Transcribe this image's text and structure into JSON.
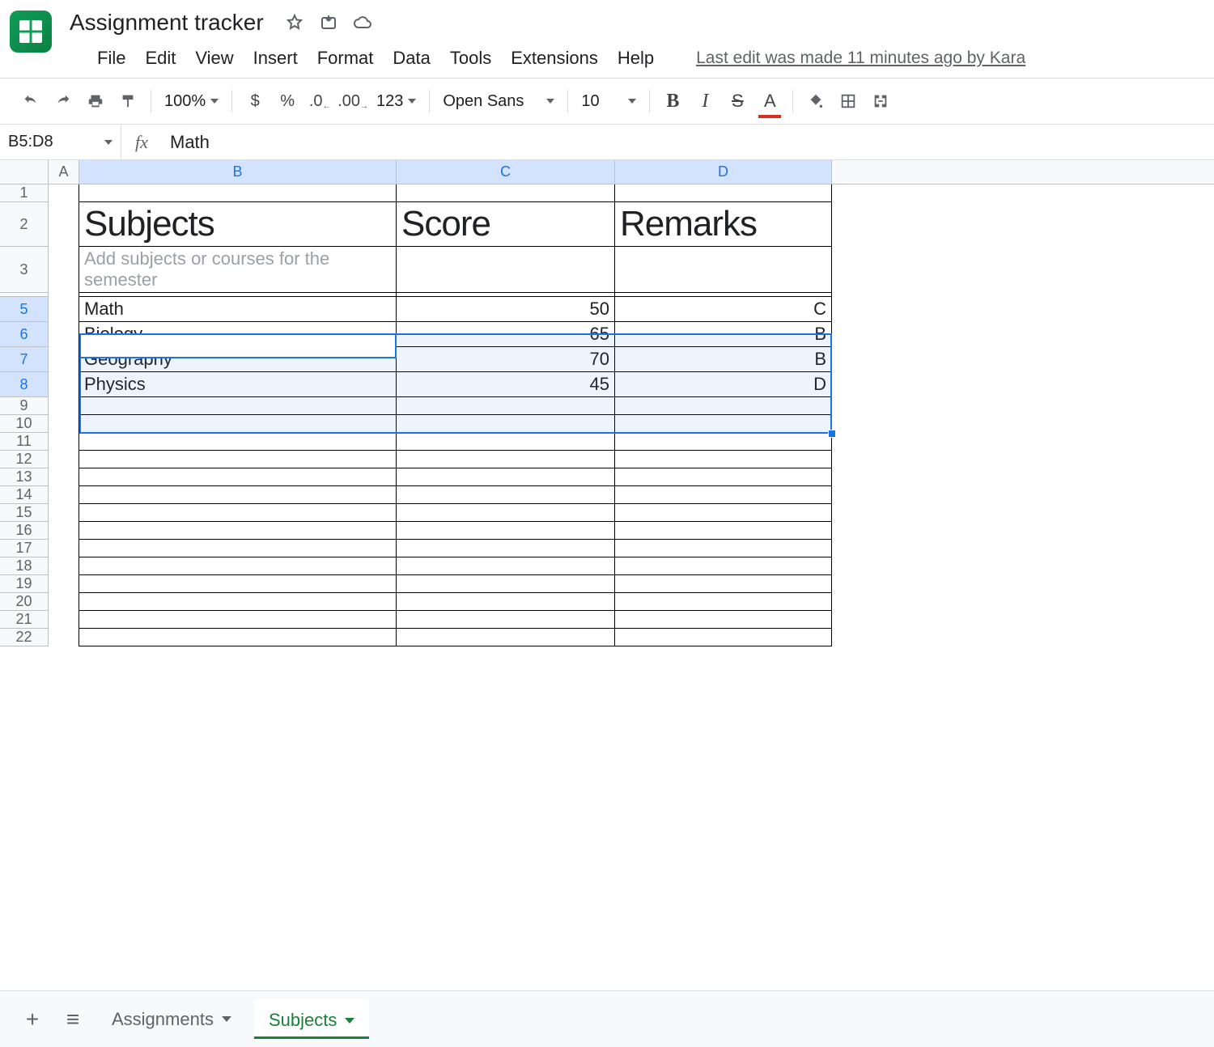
{
  "doc": {
    "title": "Assignment tracker",
    "last_edit": "Last edit was made 11 minutes ago by Kara"
  },
  "menu": {
    "file": "File",
    "edit": "Edit",
    "view": "View",
    "insert": "Insert",
    "format": "Format",
    "data": "Data",
    "tools": "Tools",
    "extensions": "Extensions",
    "help": "Help"
  },
  "toolbar": {
    "zoom": "100%",
    "currency": "$",
    "percent": "%",
    "dec_dec": ".0",
    "inc_dec": ".00",
    "more_formats": "123",
    "font": "Open Sans",
    "font_size": "10",
    "bold": "B",
    "italic": "I",
    "strike": "S",
    "text_color": "A"
  },
  "formula": {
    "name_box": "B5:D8",
    "fx": "fx",
    "value": "Math"
  },
  "columns": [
    "A",
    "B",
    "C",
    "D"
  ],
  "headers": {
    "b": "Subjects",
    "c": "Score",
    "d": "Remarks"
  },
  "hint": "Add subjects or courses for the semester",
  "rows": [
    {
      "n": 5,
      "subject": "Math",
      "score": "50",
      "remark": "C"
    },
    {
      "n": 6,
      "subject": "Biology",
      "score": "65",
      "remark": "B"
    },
    {
      "n": 7,
      "subject": "Geography",
      "score": "70",
      "remark": "B"
    },
    {
      "n": 8,
      "subject": "Physics",
      "score": "45",
      "remark": "D"
    }
  ],
  "empty_rows": [
    9,
    10,
    11,
    12,
    13,
    14,
    15,
    16,
    17,
    18,
    19,
    20,
    21,
    22
  ],
  "tabs": {
    "add": "+",
    "all": "≡",
    "assignments": "Assignments",
    "subjects": "Subjects"
  },
  "chart_data": {
    "type": "table",
    "title": "Subjects",
    "columns": [
      "Subjects",
      "Score",
      "Remarks"
    ],
    "rows": [
      [
        "Math",
        50,
        "C"
      ],
      [
        "Biology",
        65,
        "B"
      ],
      [
        "Geography",
        70,
        "B"
      ],
      [
        "Physics",
        45,
        "D"
      ]
    ]
  }
}
